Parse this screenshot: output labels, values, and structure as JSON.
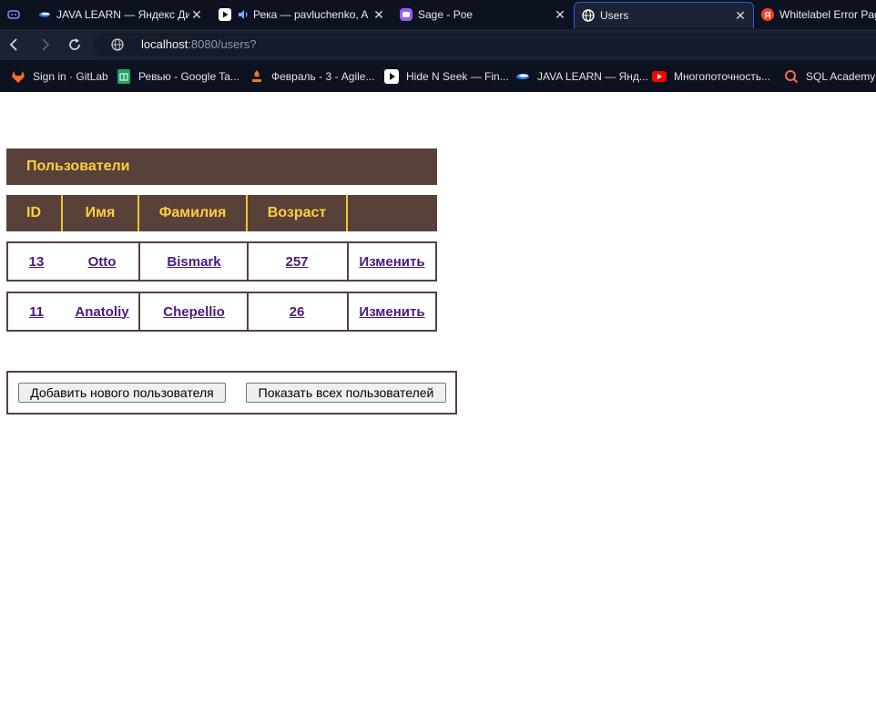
{
  "browser": {
    "tabs": [
      {
        "title": "",
        "icon": "discord-icon"
      },
      {
        "title": "JAVA LEARN — Яндекс Дис",
        "icon": "yandex-disk-icon"
      },
      {
        "title": "Река — pavluchenko, A",
        "icon": "play-icon"
      },
      {
        "title": "Sage - Poe",
        "icon": "poe-icon"
      },
      {
        "title": "Users",
        "icon": "globe-icon",
        "active": true
      },
      {
        "title": "Whitelabel Error Pag",
        "icon": "yandex-icon"
      }
    ],
    "address": {
      "host": "localhost",
      "rest": ":8080/users?"
    },
    "bookmarks": [
      {
        "label": "Sign in · GitLab",
        "icon": "gitlab-icon"
      },
      {
        "label": "Ревью - Google Ta...",
        "icon": "google-sheets-icon"
      },
      {
        "label": "Февраль - 3 - Agile...",
        "icon": "agile-icon"
      },
      {
        "label": "Hide N Seek — Fin...",
        "icon": "play-icon"
      },
      {
        "label": "JAVA LEARN — Янд...",
        "icon": "yandex-disk-icon"
      },
      {
        "label": "Многопоточность...",
        "icon": "youtube-icon"
      },
      {
        "label": "SQL Academy:",
        "icon": "sql-academy-icon"
      }
    ]
  },
  "page": {
    "title": "Пользователи",
    "columns": [
      "ID",
      "Имя",
      "Фамилия",
      "Возраст",
      ""
    ],
    "rows": [
      {
        "id": "13",
        "name": "Otto",
        "surname": "Bismark",
        "age": "257",
        "action": "Изменить"
      },
      {
        "id": "11",
        "name": "Anatoliy",
        "surname": "Chepellio",
        "age": "26",
        "action": "Изменить"
      }
    ],
    "buttons": {
      "add": "Добавить нового пользователя",
      "show_all": "Показать всех пользователей"
    }
  },
  "colors": {
    "header_bg": "#574139",
    "header_text": "#ffcf3f",
    "link": "#4b1a7a"
  }
}
